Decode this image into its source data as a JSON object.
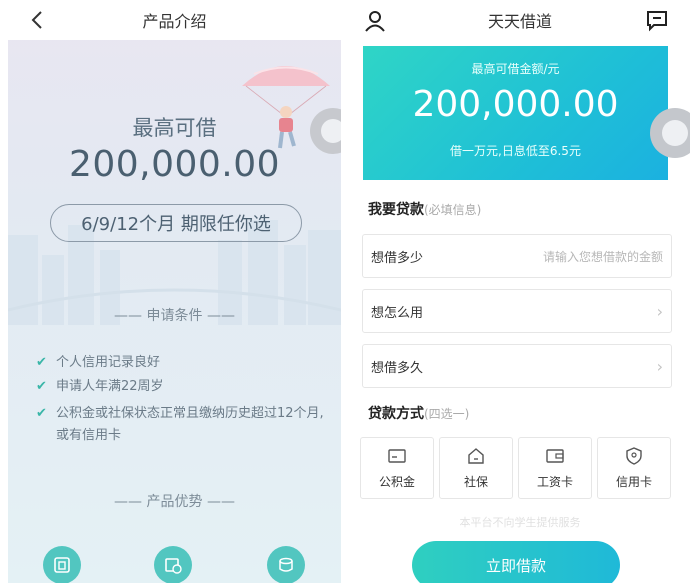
{
  "left": {
    "header_title": "产品介绍",
    "max_label": "最高可借",
    "max_amount": "200,000.00",
    "term_pill": "6/9/12个月  期限任你选",
    "conditions_title": "—— 申请条件 ——",
    "conditions": [
      "个人信用记录良好",
      "申请人年满22周岁",
      "公积金或社保状态正常且缴纳历史超过12个月,",
      "或有信用卡"
    ],
    "advantages_title": "—— 产品优势 ——"
  },
  "right": {
    "header_title": "天天借道",
    "card": {
      "label": "最高可借金额/元",
      "amount": "200,000.00",
      "note": "借一万元,日息低至6.5元"
    },
    "loan_section": {
      "title": "我要贷款",
      "hint": "(必填信息)"
    },
    "fields": [
      {
        "label": "想借多少",
        "placeholder": "请输入您想借款的金额"
      },
      {
        "label": "想怎么用"
      },
      {
        "label": "想借多久"
      }
    ],
    "method_section": {
      "title": "贷款方式",
      "hint": "(四选一)"
    },
    "methods": [
      {
        "label": "公积金",
        "icon": "card-icon"
      },
      {
        "label": "社保",
        "icon": "home-icon"
      },
      {
        "label": "工资卡",
        "icon": "wallet-icon"
      },
      {
        "label": "信用卡",
        "icon": "shield-icon"
      }
    ],
    "disclaimer": "本平台不向学生提供服务",
    "cta_label": "立即借款"
  },
  "colors": {
    "accent": "#2fcfc0",
    "accent_end": "#1fb9d8",
    "check": "#3ab6a8"
  }
}
